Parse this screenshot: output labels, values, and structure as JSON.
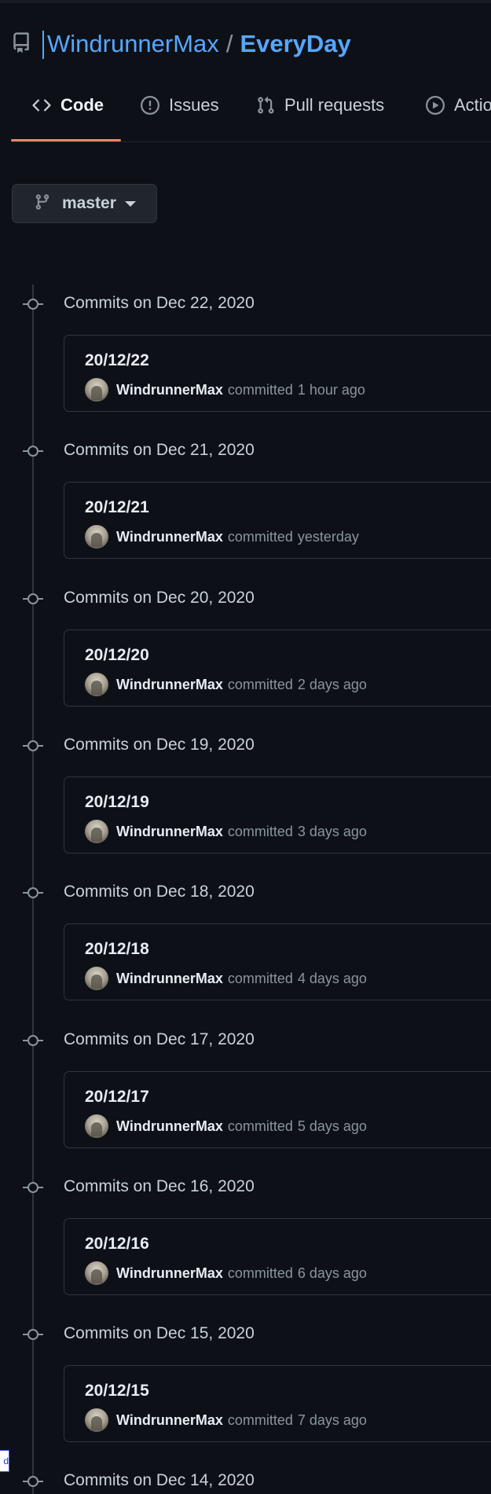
{
  "repo": {
    "owner": "WindrunnerMax",
    "separator": "/",
    "name": "EveryDay",
    "icon": "repo-icon"
  },
  "tabs": [
    {
      "label": "Code",
      "icon": "code-icon",
      "selected": true
    },
    {
      "label": "Issues",
      "icon": "issue-opened-icon",
      "selected": false
    },
    {
      "label": "Pull requests",
      "icon": "git-pull-request-icon",
      "selected": false
    },
    {
      "label": "Actions",
      "icon": "play-icon",
      "selected": false
    }
  ],
  "branch": {
    "name": "master",
    "icon": "git-branch-icon"
  },
  "commit_groups": [
    {
      "title": "Commits on Dec 22, 2020",
      "commit": {
        "message": "20/12/22",
        "author": "WindrunnerMax",
        "action": "committed",
        "time": "1 hour ago"
      }
    },
    {
      "title": "Commits on Dec 21, 2020",
      "commit": {
        "message": "20/12/21",
        "author": "WindrunnerMax",
        "action": "committed",
        "time": "yesterday"
      }
    },
    {
      "title": "Commits on Dec 20, 2020",
      "commit": {
        "message": "20/12/20",
        "author": "WindrunnerMax",
        "action": "committed",
        "time": "2 days ago"
      }
    },
    {
      "title": "Commits on Dec 19, 2020",
      "commit": {
        "message": "20/12/19",
        "author": "WindrunnerMax",
        "action": "committed",
        "time": "3 days ago"
      }
    },
    {
      "title": "Commits on Dec 18, 2020",
      "commit": {
        "message": "20/12/18",
        "author": "WindrunnerMax",
        "action": "committed",
        "time": "4 days ago"
      }
    },
    {
      "title": "Commits on Dec 17, 2020",
      "commit": {
        "message": "20/12/17",
        "author": "WindrunnerMax",
        "action": "committed",
        "time": "5 days ago"
      }
    },
    {
      "title": "Commits on Dec 16, 2020",
      "commit": {
        "message": "20/12/16",
        "author": "WindrunnerMax",
        "action": "committed",
        "time": "6 days ago"
      }
    },
    {
      "title": "Commits on Dec 15, 2020",
      "commit": {
        "message": "20/12/15",
        "author": "WindrunnerMax",
        "action": "committed",
        "time": "7 days ago"
      }
    },
    {
      "title": "Commits on Dec 14, 2020"
    }
  ],
  "side_badge": {
    "text": "d"
  },
  "colors": {
    "background": "#0d1117",
    "link": "#58a6ff",
    "tab_underline": "#f78166",
    "border": "#30363d",
    "muted": "#8b949e"
  }
}
